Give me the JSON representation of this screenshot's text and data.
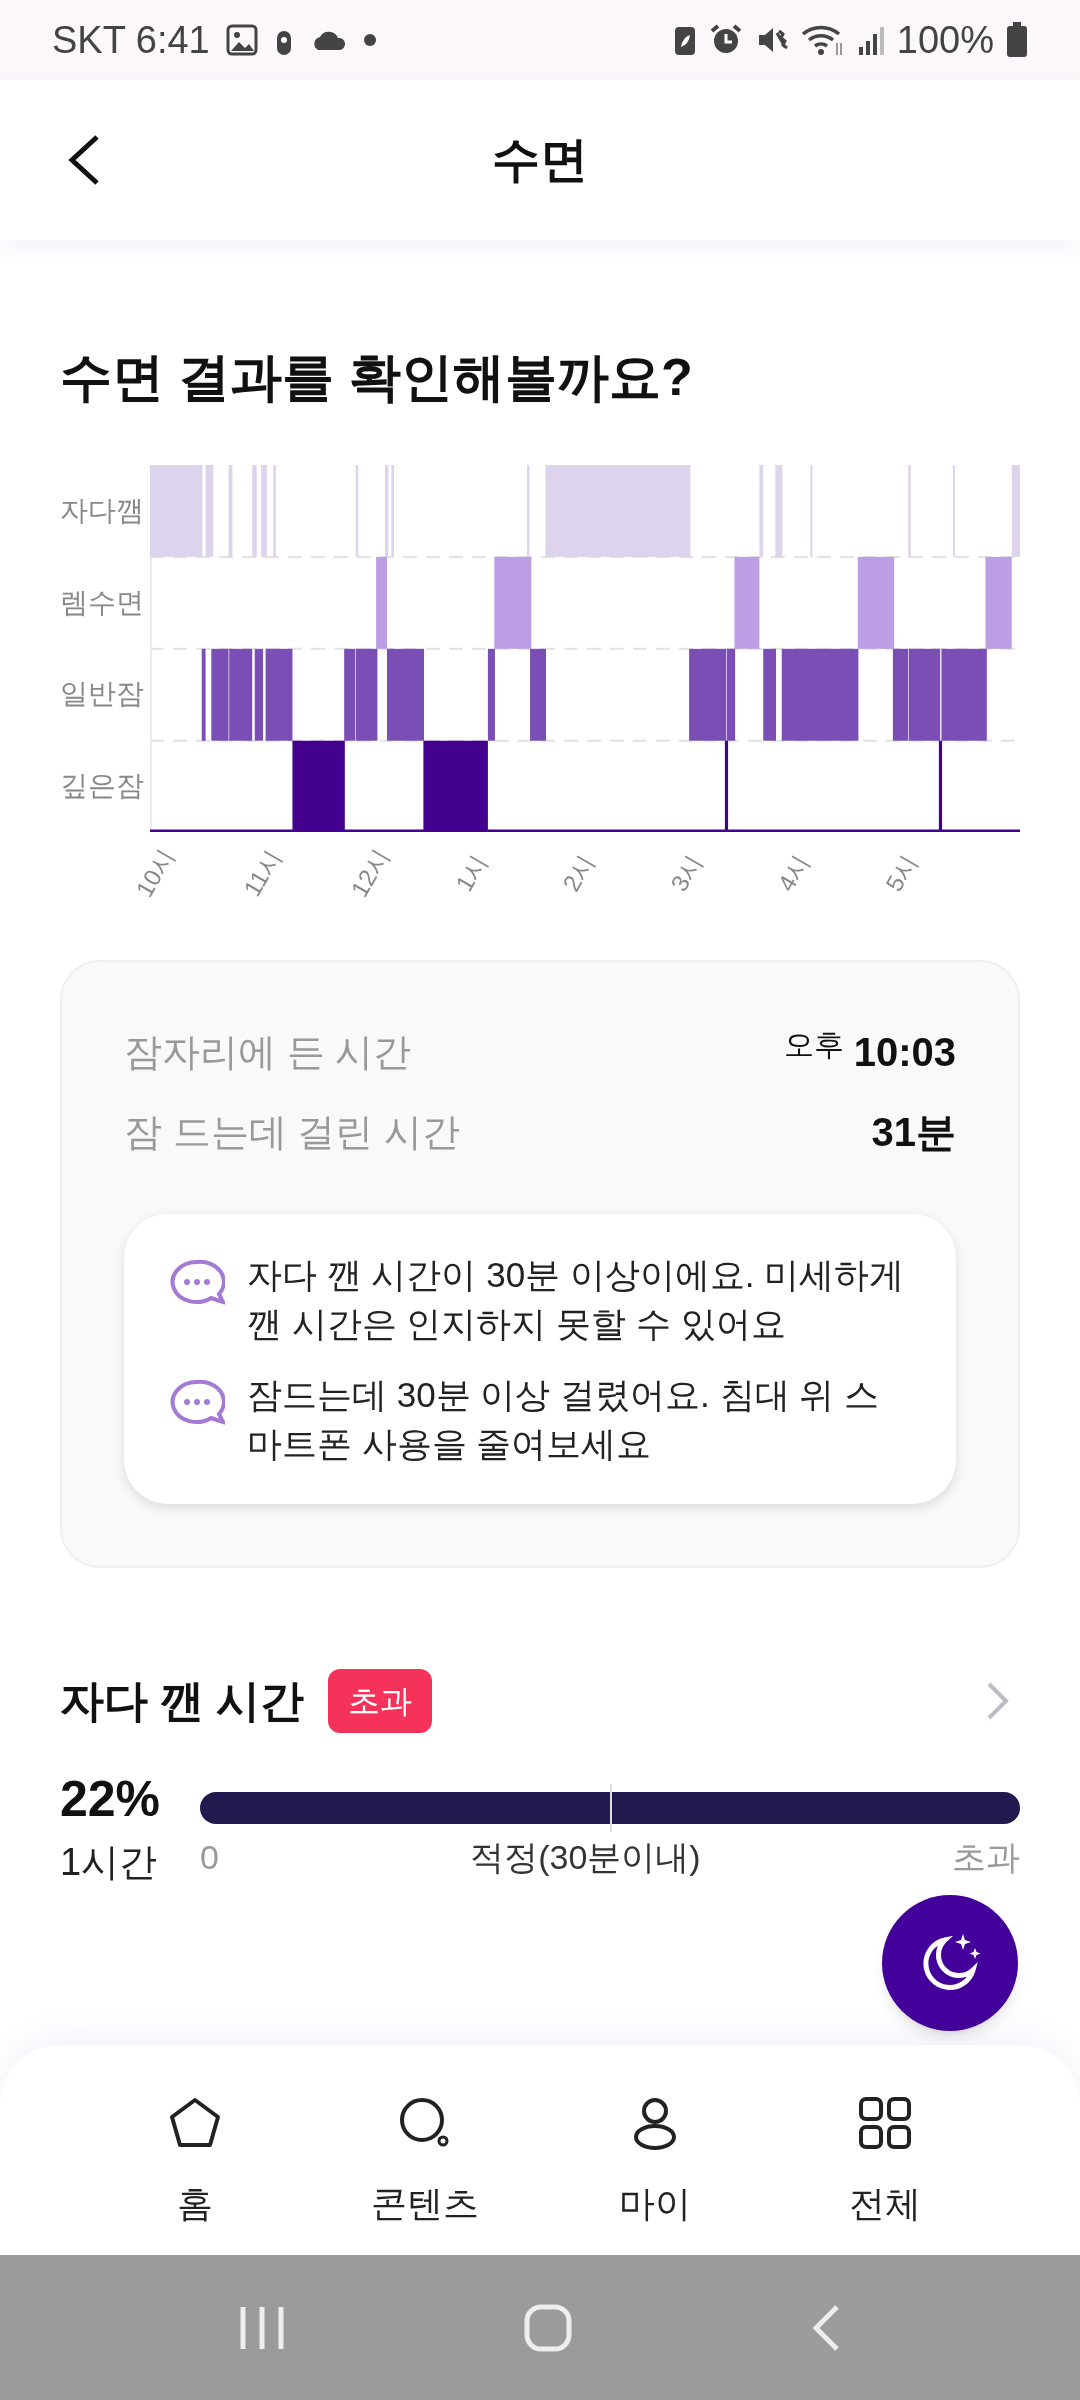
{
  "status_bar": {
    "carrier_time": "SKT 6:41",
    "battery": "100%"
  },
  "header": {
    "title": "수면"
  },
  "heading": "수면 결과를 확인해볼까요?",
  "sleep_chart": {
    "stages": [
      "자다깸",
      "렘수면",
      "일반잠",
      "깊은잠"
    ],
    "times": [
      "10시",
      "11시",
      "12시",
      "1시",
      "2시",
      "3시",
      "4시",
      "5시"
    ]
  },
  "summary": {
    "rows": [
      {
        "label": "잠자리에 든 시간",
        "prefix": "오후",
        "value": "10:03"
      },
      {
        "label": "잠 드는데 걸린 시간",
        "value": "31분"
      }
    ],
    "tips": [
      "자다 깬 시간이 30분 이상이에요. 미세하게 깬 시간은 인지하지 못할 수 있어요",
      "잠드는데 30분 이상 걸렸어요. 침대 위 스마트폰 사용을 줄여보세요"
    ]
  },
  "wake_section": {
    "title": "자다 깬 시간",
    "badge": "초과",
    "percent": "22%",
    "duration": "1시간",
    "level": 1,
    "scale": [
      "0",
      "적정(30분이내)",
      "초과"
    ]
  },
  "bottom_nav": [
    {
      "kind": "home",
      "label": "홈"
    },
    {
      "kind": "content",
      "label": "콘텐츠"
    },
    {
      "kind": "my",
      "label": "마이"
    },
    {
      "kind": "all",
      "label": "전체"
    }
  ]
}
